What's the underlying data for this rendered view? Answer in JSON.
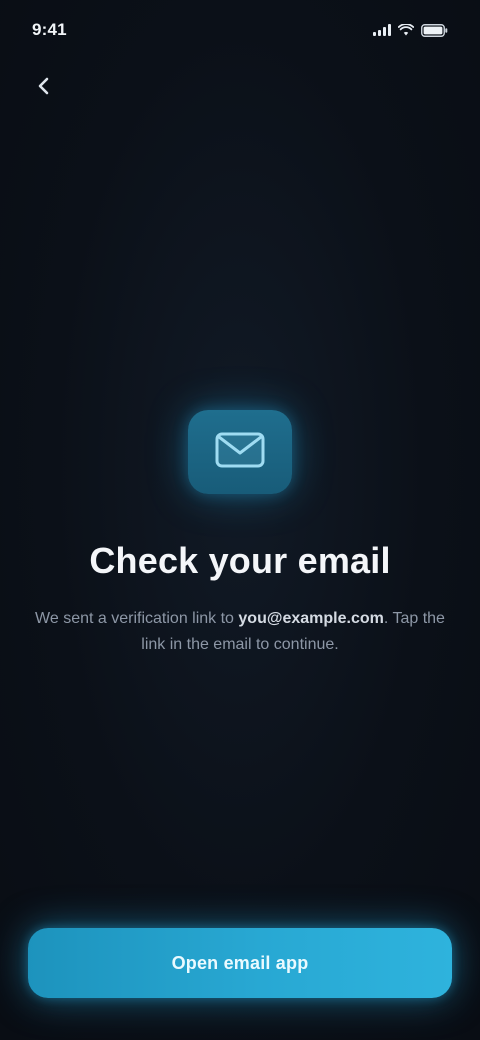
{
  "status_bar": {
    "time": "9:41",
    "icons": [
      "signal-icon",
      "wifi-icon",
      "battery-icon"
    ]
  },
  "nav": {
    "back_icon": "chevron-left-icon"
  },
  "content": {
    "icon": "mail-icon",
    "headline": "Check your email",
    "instructions_before": "We sent a verification link to ",
    "email": "you@example.com",
    "instructions_after": ". Tap the link in the email to continue."
  },
  "primary_action": {
    "label": "Open email app"
  },
  "colors": {
    "background": "#0b1018",
    "accent": "#28a8d3",
    "badge": "#1f6e8e",
    "muted_text": "#8d97a6"
  }
}
